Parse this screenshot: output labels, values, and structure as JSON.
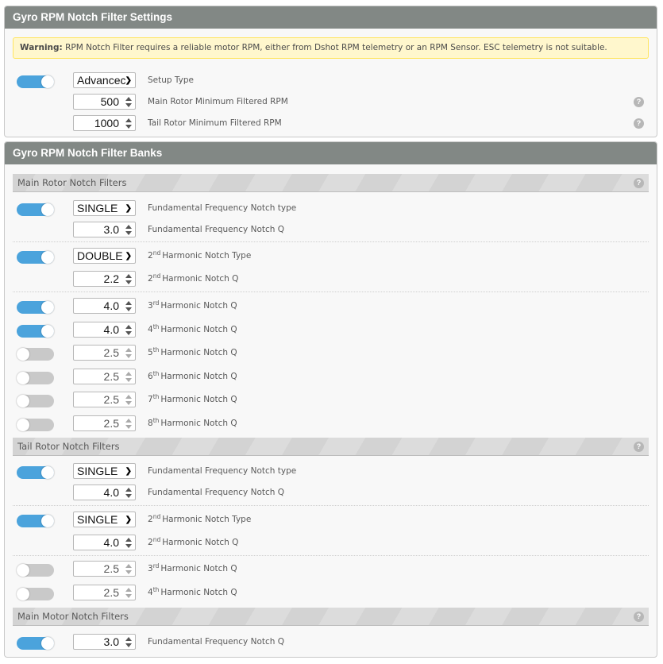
{
  "settings": {
    "title": "Gyro RPM Notch Filter Settings",
    "warning": {
      "label": "Warning:",
      "text": " RPM Notch Filter requires a reliable motor RPM, either from Dshot RPM telemetry or an RPM Sensor. ESC telemetry is not suitable."
    },
    "enabled": true,
    "setup_type": {
      "value": "Advanced",
      "display": "Advancec",
      "label": "Setup Type"
    },
    "main_min_rpm": {
      "value": "500",
      "label": "Main Rotor Minimum Filtered RPM"
    },
    "tail_min_rpm": {
      "value": "1000",
      "label": "Tail Rotor Minimum Filtered RPM"
    },
    "help_glyph": "?"
  },
  "banks": {
    "title": "Gyro RPM Notch Filter Banks",
    "main_rotor": {
      "title": "Main Rotor Notch Filters",
      "fund_type": {
        "enabled": true,
        "value": "SINGLE",
        "label": "Fundamental Frequency Notch type"
      },
      "fund_q": {
        "value": "3.0",
        "label": "Fundamental Frequency Notch Q"
      },
      "h2_type": {
        "enabled": true,
        "value": "DOUBLE",
        "num": "2",
        "sup": "nd",
        "label": "Harmonic Notch Type"
      },
      "h2_q": {
        "value": "2.2",
        "num": "2",
        "sup": "nd",
        "label": "Harmonic Notch Q"
      },
      "harmonics": [
        {
          "enabled": true,
          "value": "4.0",
          "num": "3",
          "sup": "rd",
          "label": "Harmonic Notch Q"
        },
        {
          "enabled": true,
          "value": "4.0",
          "num": "4",
          "sup": "th",
          "label": "Harmonic Notch Q"
        },
        {
          "enabled": false,
          "value": "2.5",
          "num": "5",
          "sup": "th",
          "label": "Harmonic Notch Q"
        },
        {
          "enabled": false,
          "value": "2.5",
          "num": "6",
          "sup": "th",
          "label": "Harmonic Notch Q"
        },
        {
          "enabled": false,
          "value": "2.5",
          "num": "7",
          "sup": "th",
          "label": "Harmonic Notch Q"
        },
        {
          "enabled": false,
          "value": "2.5",
          "num": "8",
          "sup": "th",
          "label": "Harmonic Notch Q"
        }
      ]
    },
    "tail_rotor": {
      "title": "Tail Rotor Notch Filters",
      "fund_type": {
        "enabled": true,
        "value": "SINGLE",
        "label": "Fundamental Frequency Notch type"
      },
      "fund_q": {
        "value": "4.0",
        "label": "Fundamental Frequency Notch Q"
      },
      "h2_type": {
        "enabled": true,
        "value": "SINGLE",
        "num": "2",
        "sup": "nd",
        "label": "Harmonic Notch Type"
      },
      "h2_q": {
        "value": "4.0",
        "num": "2",
        "sup": "nd",
        "label": "Harmonic Notch Q"
      },
      "harmonics": [
        {
          "enabled": false,
          "value": "2.5",
          "num": "3",
          "sup": "rd",
          "label": "Harmonic Notch Q"
        },
        {
          "enabled": false,
          "value": "2.5",
          "num": "4",
          "sup": "th",
          "label": "Harmonic Notch Q"
        }
      ]
    },
    "main_motor": {
      "title": "Main Motor Notch Filters",
      "fund_q": {
        "enabled": true,
        "value": "3.0",
        "label": "Fundamental Frequency Notch Q"
      }
    }
  },
  "colors": {
    "header_bg": "#828885",
    "toggle_on": "#4ba3dc",
    "toggle_off": "#c9c9c9",
    "warning_bg": "#fff7cd",
    "warning_border": "#ffe55f"
  }
}
